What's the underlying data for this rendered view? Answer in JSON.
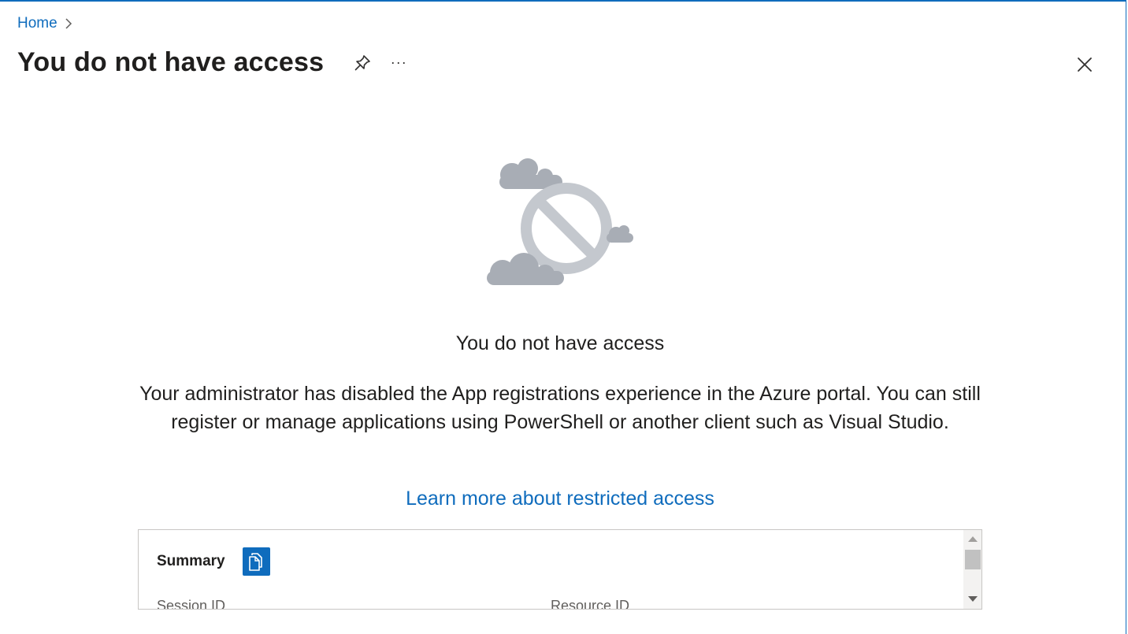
{
  "breadcrumb": {
    "home_label": "Home"
  },
  "header": {
    "title": "You do not have access",
    "more_label": "···"
  },
  "message": {
    "heading": "You do not have access",
    "body": "Your administrator has disabled the App registrations experience in the Azure portal. You can still register or manage applications using PowerShell or another client such as Visual Studio.",
    "link_label": "Learn more about restricted access"
  },
  "summary": {
    "title": "Summary",
    "session_id_label": "Session ID",
    "resource_id_label": "Resource ID"
  },
  "colors": {
    "accent": "#0f6cbd",
    "illustration_gray": "#a8adb5",
    "illustration_circle": "#c4c8ce"
  },
  "icons": {
    "breadcrumb_separator": "chevron-right-icon",
    "pin": "pin-icon",
    "more": "more-icon",
    "close": "close-icon",
    "copy": "copy-icon",
    "illustration": "no-access-illustration"
  }
}
